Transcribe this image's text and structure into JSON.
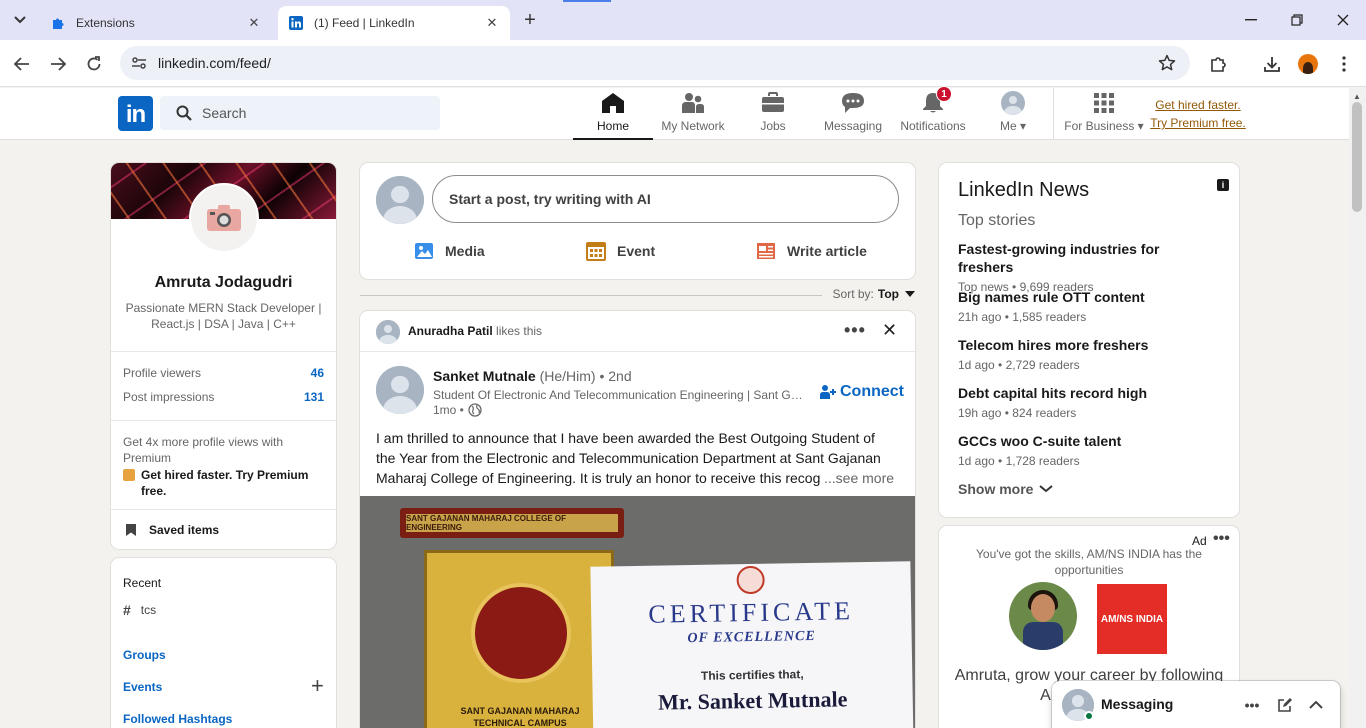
{
  "browser": {
    "tabs": [
      {
        "title": "Extensions",
        "icon": "puzzle-icon",
        "active": false
      },
      {
        "title": "(1) Feed | LinkedIn",
        "icon": "linkedin-icon",
        "active": true
      }
    ],
    "url": "linkedin.com/feed/"
  },
  "header": {
    "logo": "in",
    "search_placeholder": "Search",
    "nav": [
      {
        "label": "Home",
        "icon": "home-icon",
        "active": true
      },
      {
        "label": "My Network",
        "icon": "network-icon",
        "active": false
      },
      {
        "label": "Jobs",
        "icon": "briefcase-icon",
        "active": false
      },
      {
        "label": "Messaging",
        "icon": "chat-icon",
        "active": false
      },
      {
        "label": "Notifications",
        "icon": "bell-icon",
        "active": false,
        "badge": "1"
      },
      {
        "label": "Me",
        "icon": "avatar-icon",
        "active": false
      },
      {
        "label": "For Business",
        "icon": "grid-icon",
        "active": false
      }
    ],
    "premium_line1": "Get hired faster.",
    "premium_line2": "Try Premium free."
  },
  "profile": {
    "name": "Amruta Jodagudri",
    "headline": "Passionate MERN Stack Developer | React.js | DSA | Java | C++",
    "stats": [
      {
        "label": "Profile viewers",
        "value": "46"
      },
      {
        "label": "Post impressions",
        "value": "131"
      }
    ],
    "premium_lead": "Get 4x more profile views with Premium",
    "premium_cta": "Get hired faster. Try Premium free.",
    "saved": "Saved items"
  },
  "sidebar": {
    "recent_title": "Recent",
    "recent_items": [
      "tcs"
    ],
    "groups": "Groups",
    "events": "Events",
    "hashtags": "Followed Hashtags"
  },
  "share": {
    "placeholder": "Start a post, try writing with AI",
    "actions": [
      {
        "label": "Media",
        "icon": "image-icon",
        "color": "#378fe9"
      },
      {
        "label": "Event",
        "icon": "calendar-icon",
        "color": "#c37d16"
      },
      {
        "label": "Write article",
        "icon": "article-icon",
        "color": "#e06847"
      }
    ]
  },
  "sort": {
    "label": "Sort by:",
    "value": "Top"
  },
  "post": {
    "liker": "Anuradha Patil",
    "liker_suffix": "likes this",
    "author": "Sanket Mutnale",
    "pronouns": "(He/Him)",
    "degree": "• 2nd",
    "author_sub": "Student Of Electronic And Telecommunication Engineering | Sant Gajanan Maharaj College of Engineering",
    "time": "1mo •",
    "connect": "Connect",
    "body": "I am thrilled to announce that I have been awarded the Best Outgoing Student of the Year from the Electronic and Telecommunication Department at Sant Gajanan Maharaj College of Engineering. It is truly an honor to receive this recognition",
    "see_more": "...see more",
    "image": {
      "trophy_label": "SANT GAJANAN MAHARAJ COLLEGE OF ENGINEERING",
      "trophy_text": "SANT GAJANAN MAHARAJ TECHNICAL CAMPUS MAHAGAON",
      "cert_title": "CERTIFICATE",
      "cert_sub": "OF EXCELLENCE",
      "cert_line": "This certifies that,",
      "cert_name": "Mr. Sanket Mutnale"
    }
  },
  "news": {
    "title": "LinkedIn News",
    "subtitle": "Top stories",
    "items": [
      {
        "headline": "Fastest-growing industries for freshers",
        "meta": "Top news • 9,699 readers"
      },
      {
        "headline": "Big names rule OTT content",
        "meta": "21h ago • 1,585 readers"
      },
      {
        "headline": "Telecom hires more freshers",
        "meta": "1d ago • 2,729 readers"
      },
      {
        "headline": "Debt capital hits record high",
        "meta": "19h ago • 824 readers"
      },
      {
        "headline": "GCCs woo C-suite talent",
        "meta": "1d ago • 1,728 readers"
      }
    ],
    "show_more": "Show more"
  },
  "ad": {
    "label": "Ad",
    "text": "You've got the skills, AM/NS INDIA has the opportunities",
    "logo_text": "AM/NS INDIA",
    "cta": "Amruta, grow your career by following AM/NS INDIA"
  },
  "messaging": {
    "label": "Messaging"
  },
  "colors": {
    "brand": "#0a66c2",
    "badge": "#cb112d",
    "premium": "#915907"
  }
}
